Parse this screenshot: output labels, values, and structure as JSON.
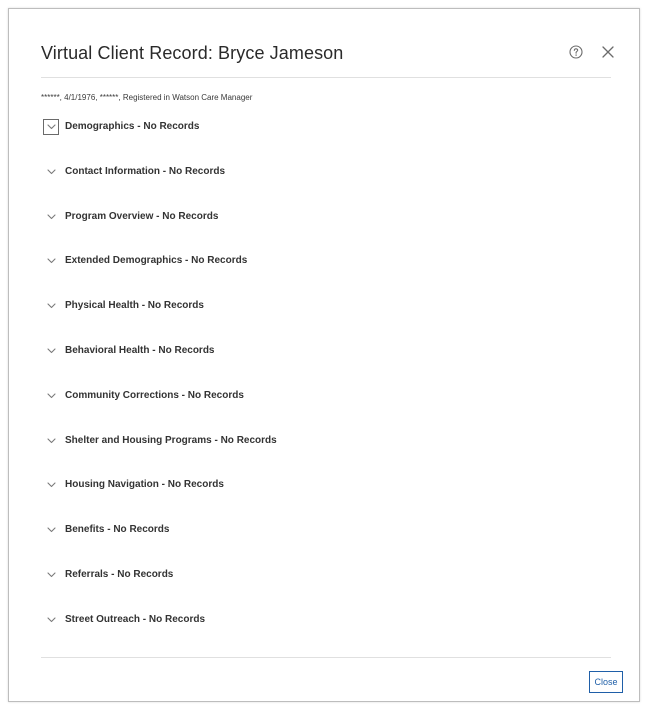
{
  "dialog": {
    "title": "Virtual Client Record: Bryce Jameson",
    "subtitle": "******, 4/1/1976, ******, Registered in Watson Care Manager",
    "close_button_label": "Close",
    "help_icon": "help-circle-icon",
    "dismiss_icon": "close-icon"
  },
  "sections": [
    {
      "label": "Demographics - No Records",
      "focused": true
    },
    {
      "label": "Contact Information - No Records",
      "focused": false
    },
    {
      "label": "Program Overview - No Records",
      "focused": false
    },
    {
      "label": "Extended Demographics - No Records",
      "focused": false
    },
    {
      "label": "Physical Health - No Records",
      "focused": false
    },
    {
      "label": "Behavioral Health - No Records",
      "focused": false
    },
    {
      "label": "Community Corrections - No Records",
      "focused": false
    },
    {
      "label": "Shelter and Housing Programs - No Records",
      "focused": false
    },
    {
      "label": "Housing Navigation - No Records",
      "focused": false
    },
    {
      "label": "Benefits - No Records",
      "focused": false
    },
    {
      "label": "Referrals - No Records",
      "focused": false
    },
    {
      "label": "Street Outreach - No Records",
      "focused": false
    }
  ],
  "colors": {
    "accent": "#1f5fa8",
    "text": "#333333",
    "divider": "#e0e0e0"
  }
}
